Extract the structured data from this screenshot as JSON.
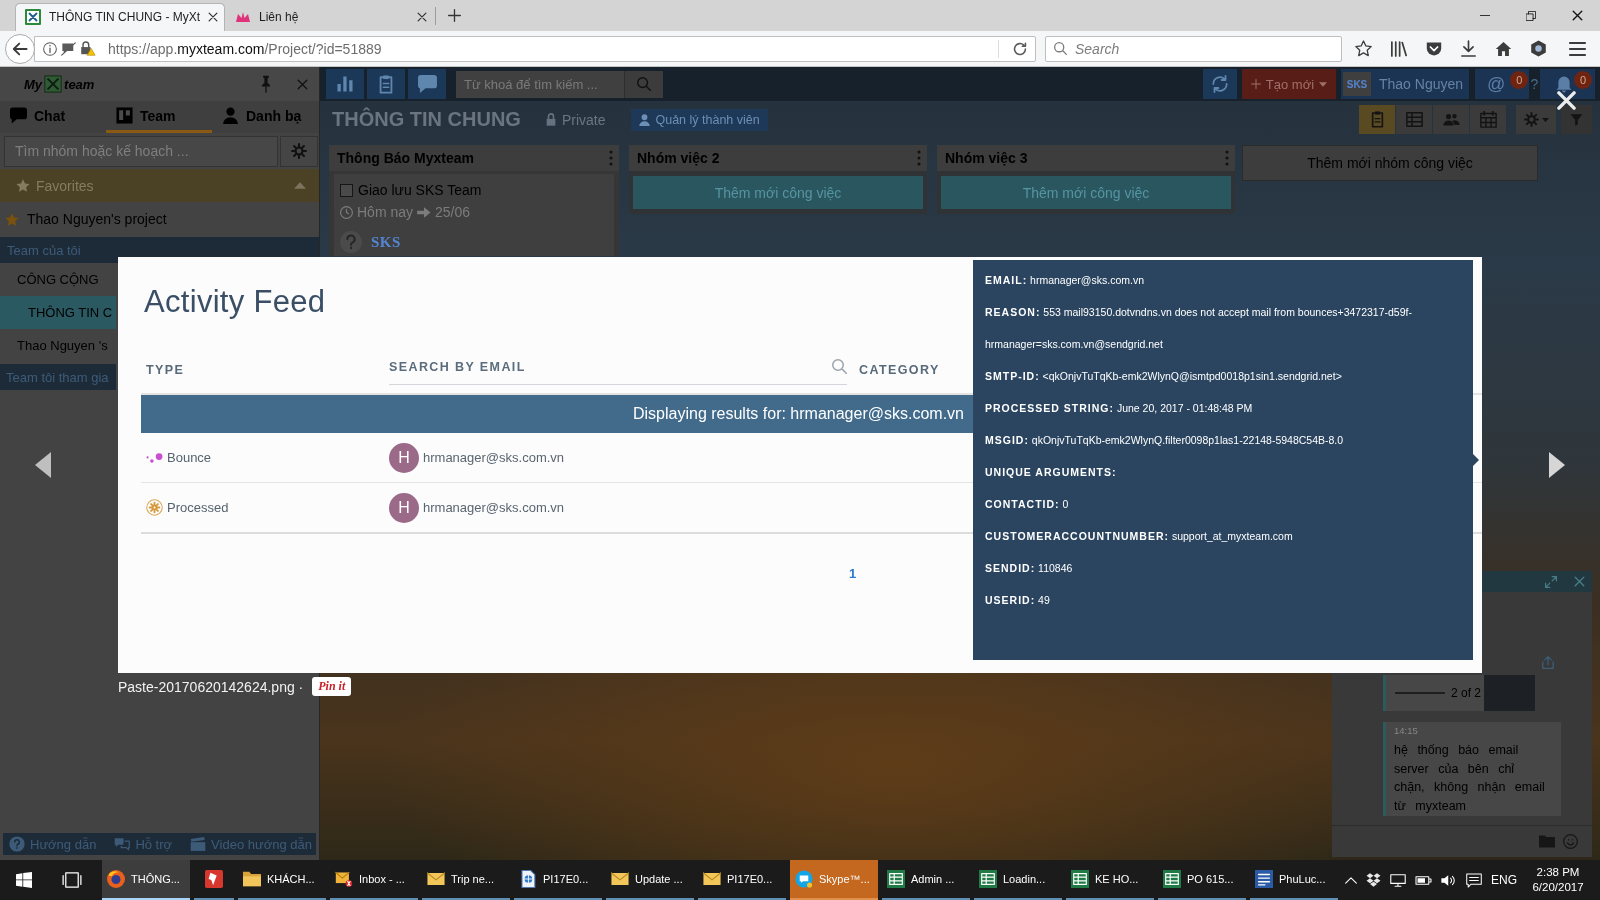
{
  "browser": {
    "tabs": [
      {
        "title": "THÔNG TIN CHUNG - MyXt",
        "selected": true
      },
      {
        "title": "Liên hệ",
        "selected": false
      }
    ],
    "url": {
      "start": "https://app.",
      "domain": "myxteam.com",
      "rest": "/Project/?id=51889"
    },
    "search": {
      "placeholder": "Search"
    }
  },
  "sidebar": {
    "logo": {
      "before": "My",
      "after": "team"
    },
    "tabs": [
      {
        "kind": "chat",
        "label": "Chat",
        "selected": false
      },
      {
        "kind": "team",
        "label": "Team",
        "selected": true
      },
      {
        "kind": "contacts",
        "label": "Danh bạ",
        "selected": false
      }
    ],
    "search": {
      "placeholder": "Tìm nhóm hoặc kế hoạch ..."
    },
    "favorites": {
      "label": "Favorites",
      "expanded": true,
      "items": [
        {
          "label": "Thao Nguyen's project"
        }
      ]
    },
    "sections": [
      {
        "label": "Team của tôi",
        "items": [
          {
            "label": "CÔNG CỘNG",
            "selected": false,
            "children": [
              {
                "label": "THÔNG TIN C",
                "selected": true
              }
            ]
          },
          {
            "label": "Thao Nguyen 's",
            "selected": false
          }
        ]
      },
      {
        "label": "Team tôi tham gia"
      }
    ],
    "footer": [
      {
        "kind": "help",
        "label": "Hướng dẫn"
      },
      {
        "kind": "support",
        "label": "Hỗ trợ"
      },
      {
        "kind": "video",
        "label": "Video hướng dẫn"
      }
    ]
  },
  "topbar": {
    "search": {
      "placeholder": "Từ khoá để tìm kiếm ..."
    },
    "create_button": "Tạo mới",
    "user": {
      "org_logo": "SKS",
      "name": "Thao Nguyen"
    },
    "mentions": {
      "symbol": "@",
      "badge": "0"
    },
    "help_symbol": "?",
    "notifications": {
      "badge": "0"
    }
  },
  "project": {
    "title": "THÔNG TIN CHUNG",
    "privacy": "Private",
    "members_button": "Quản lý thành viên",
    "views": [
      {
        "kind": "board",
        "selected": true
      },
      {
        "kind": "table",
        "selected": false
      },
      {
        "kind": "members",
        "selected": false
      },
      {
        "kind": "calendar",
        "selected": false
      }
    ]
  },
  "board": {
    "lists": [
      {
        "title": "Thông Báo Myxteam",
        "cards": [
          {
            "title": "Giao lưu SKS Team",
            "checked": false,
            "start": "Hôm nay",
            "due": "25/06",
            "logo": "SKS"
          }
        ]
      },
      {
        "title": "Nhóm việc 2",
        "add_task": "Thêm mới công việc"
      },
      {
        "title": "Nhóm việc 3",
        "add_task": "Thêm mới công việc"
      }
    ],
    "add_list": "Thêm mới nhóm công việc"
  },
  "chat_panel": {
    "gallery_counter": "2 of 2",
    "messages": [
      {
        "time": "14:15",
        "text": "hệ thống báo email server của bên chỉ chặn, không nhận email từ myxteam"
      }
    ]
  },
  "lightbox": {
    "caption": "Paste-20170620142624.png ·",
    "pin_button": "Pin it",
    "feed": {
      "title": "Activity Feed",
      "type_header": "TYPE",
      "email_search": {
        "placeholder": "SEARCH BY EMAIL"
      },
      "category_header": "CATEGORY",
      "banner": "Displaying results for: hrmanager@sks.com.vn",
      "rows": [
        {
          "kind": "bounce",
          "type": "Bounce",
          "avatar": "H",
          "email": "hrmanager@sks.com.vn"
        },
        {
          "kind": "processed",
          "type": "Processed",
          "avatar": "H",
          "email": "hrmanager@sks.com.vn"
        }
      ],
      "pages": [
        {
          "label": "1",
          "selected": true
        }
      ],
      "details": [
        {
          "label": "EMAIL:",
          "value": "hrmanager@sks.com.vn"
        },
        {
          "label": "REASON:",
          "value": "553 mail93150.dotvndns.vn does not accept mail from bounces+3472317-d59f-hrmanager=sks.com.vn@sendgrid.net"
        },
        {
          "label": "SMTP-ID:",
          "value": "<qkOnjvTuTqKb-emk2WlynQ@ismtpd0018p1sin1.sendgrid.net>"
        },
        {
          "label": "PROCESSED STRING:",
          "value": "June 20, 2017 - 01:48:48 PM"
        },
        {
          "label": "MSGID:",
          "value": "qkOnjvTuTqKb-emk2WlynQ.filter0098p1las1-22148-5948C54B-8.0"
        },
        {
          "label": "UNIQUE ARGUMENTS:"
        },
        {
          "label": "CONTACTID:",
          "value": "0"
        },
        {
          "label": "CUSTOMERACCOUNTNUMBER:",
          "value": "support_at_myxteam.com"
        },
        {
          "label": "SENDID:",
          "value": "110846"
        },
        {
          "label": "USERID:",
          "value": "49"
        }
      ]
    }
  },
  "taskbar": {
    "apps": [
      {
        "kind": "browser",
        "label": "THÔNG...",
        "selected": true,
        "attention": false
      },
      {
        "kind": "app",
        "selected": false,
        "attention": false
      },
      {
        "kind": "folder",
        "label": "KHÁCH...",
        "selected": false,
        "attention": false
      },
      {
        "kind": "mail-error",
        "label": "Inbox - ...",
        "selected": false,
        "attention": false
      },
      {
        "kind": "mail",
        "label": "Trip ne...",
        "selected": false,
        "attention": false
      },
      {
        "kind": "document",
        "label": "PI17E0...",
        "selected": false,
        "attention": false
      },
      {
        "kind": "mail",
        "label": "Update ...",
        "selected": false,
        "attention": false
      },
      {
        "kind": "mail",
        "label": "PI17E0...",
        "selected": false,
        "attention": false
      },
      {
        "kind": "chat",
        "label": "Skype™...",
        "selected": false,
        "attention": true
      },
      {
        "kind": "spreadsheet",
        "label": "Admin ...",
        "selected": false,
        "attention": false
      },
      {
        "kind": "spreadsheet",
        "label": "Loadin...",
        "selected": false,
        "attention": false
      },
      {
        "kind": "spreadsheet",
        "label": "KE HO...",
        "selected": false,
        "attention": false
      },
      {
        "kind": "spreadsheet",
        "label": "PO 615...",
        "selected": false,
        "attention": false
      },
      {
        "kind": "word",
        "label": "PhuLuc...",
        "selected": false,
        "attention": false
      }
    ],
    "tray": {
      "language": "ENG",
      "time": "2:38 PM",
      "date": "6/20/2017"
    }
  }
}
